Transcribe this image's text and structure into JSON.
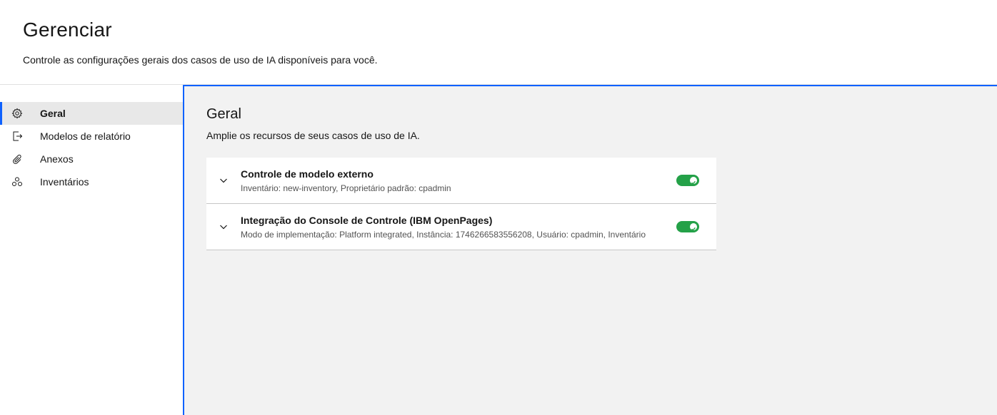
{
  "header": {
    "title": "Gerenciar",
    "description": "Controle as configurações gerais dos casos de uso de IA disponíveis para você."
  },
  "sidebar": {
    "items": [
      {
        "label": "Geral",
        "icon": "gear-icon",
        "active": true
      },
      {
        "label": "Modelos de relatório",
        "icon": "export-icon",
        "active": false
      },
      {
        "label": "Anexos",
        "icon": "paperclip-icon",
        "active": false
      },
      {
        "label": "Inventários",
        "icon": "inventory-icon",
        "active": false
      }
    ]
  },
  "main": {
    "title": "Geral",
    "description": "Amplie os recursos de seus casos de uso de IA.",
    "settings": [
      {
        "title": "Controle de modelo externo",
        "subtitle": "Inventário: new-inventory, Proprietário padrão: cpadmin",
        "enabled": true
      },
      {
        "title": "Integração do Console de Controle (IBM OpenPages)",
        "subtitle": "Modo de implementação: Platform integrated, Instância: 1746266583556208, Usuário: cpadmin, Inventário",
        "enabled": true
      }
    ]
  },
  "colors": {
    "accent": "#0f62fe",
    "toggle_on": "#24a148",
    "content_bg": "#f2f2f2"
  }
}
